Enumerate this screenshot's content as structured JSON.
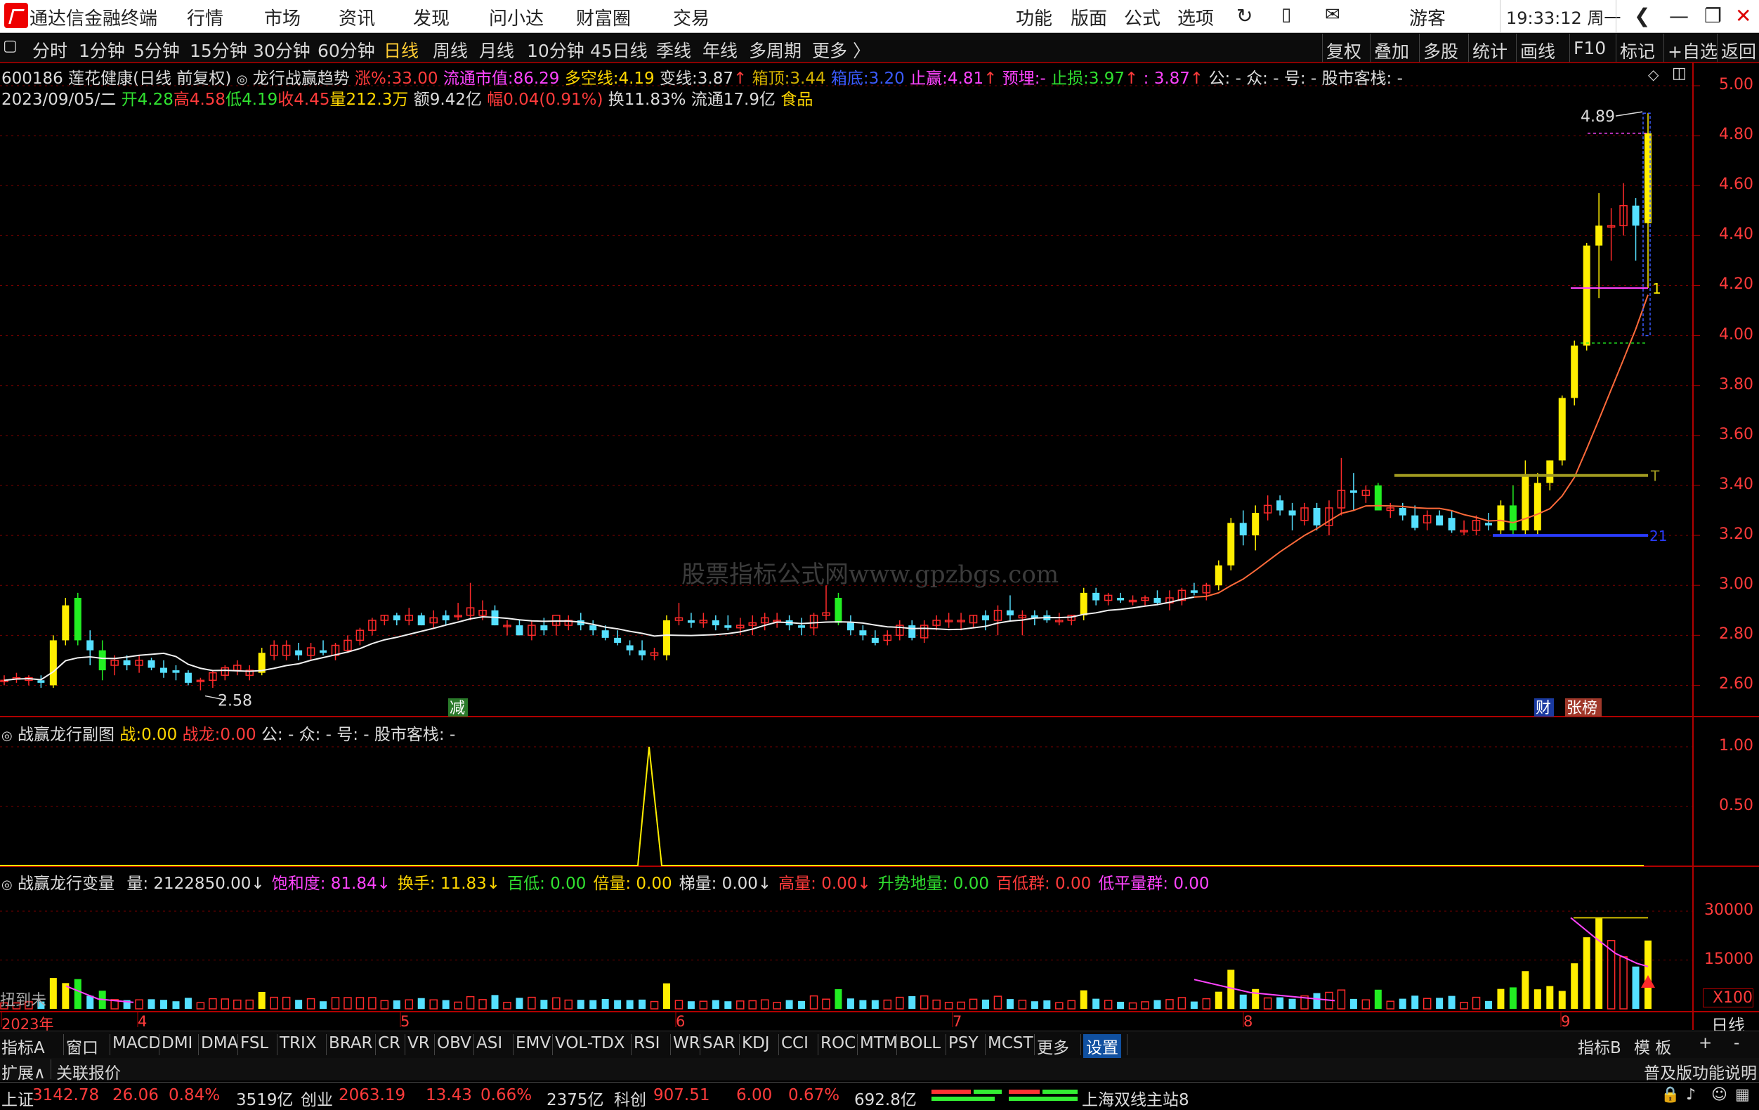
{
  "titlebar": {
    "app_name": "通达信金融终端",
    "menu": [
      "行情",
      "市场",
      "资讯",
      "发现",
      "问小达",
      "财富圈",
      "交易"
    ],
    "right_menu": [
      "功能",
      "版面",
      "公式",
      "选项"
    ],
    "user": "游客",
    "clock": "19:33:12 周一"
  },
  "periods": [
    "分时",
    "1分钟",
    "5分钟",
    "15分钟",
    "30分钟",
    "60分钟",
    "日线",
    "周线",
    "月线",
    "10分钟",
    "45日线",
    "季线",
    "年线",
    "多周期",
    "更多 〉"
  ],
  "active_period": "日线",
  "right_tools": [
    "复权",
    "叠加",
    "多股",
    "统计",
    "画线",
    "F10",
    "标记",
    "+自选",
    "返回"
  ],
  "main_info": {
    "stock": "600186 莲花健康(日线 前复权)",
    "indicator_name": "龙行战赢趋势",
    "zhang_label": "涨%:",
    "zhang_val": "33.00",
    "ltsz_label": "流通市值:",
    "ltsz_val": "86.29",
    "dkx_label": "多空线:",
    "dkx_val": "4.19",
    "bx_label": "变线:",
    "bx_val": "3.87",
    "xd_label": "箱顶:",
    "xd_val": "3.44",
    "xdi_label": "箱底:",
    "xdi_val": "3.20",
    "zy_label": "止赢:",
    "zy_val": "4.81",
    "ym_label": "预埋:",
    "ym_val": "-",
    "zs_label": "止损:",
    "zs_val": "3.97",
    "extra": ": 3.87",
    "tail": "公: -  众: -  号: -  股市客栈: -"
  },
  "ohlc_line": {
    "date": "2023/09/05/二",
    "open": "开4.28",
    "high": "高4.58",
    "low": "低4.19",
    "close": "收4.45",
    "vol": "量212.3万",
    "amt": "额9.42亿",
    "amp": "幅0.04(0.91%)",
    "turn": "换11.83%",
    "float": "流通17.9亿",
    "sector": "食品"
  },
  "price_axis": [
    "5.00",
    "4.80",
    "4.60",
    "4.40",
    "4.20",
    "4.00",
    "3.80",
    "3.60",
    "3.40",
    "3.20",
    "3.00",
    "2.80",
    "2.60"
  ],
  "sub_axis": [
    "1.00",
    "0.50"
  ],
  "vol_axis": [
    "30000",
    "15000",
    "X100"
  ],
  "chart_labels": {
    "high_mark": "4.89",
    "low_mark": "2.58",
    "box_top_tag": "T",
    "box_bottom_tag": "21",
    "stop_tag": "1",
    "event_jian": "减",
    "event_cai": "财",
    "event_zb": "张榜",
    "watermark": "股票指标公式网www.gpzbgs.com"
  },
  "sub_info": {
    "name": "战赢龙行副图",
    "z_label": "战:",
    "z_val": "0.00",
    "zl_label": "战龙:",
    "zl_val": "0.00",
    "tail": "公: -  众: -  号: -  股市客栈: -"
  },
  "vol_info": {
    "name": "战赢龙行变量",
    "items": [
      {
        "label": "量:",
        "val": "2122850.00↓",
        "color": "#dcdcdc"
      },
      {
        "label": "饱和度:",
        "val": "81.84↓",
        "color": "#ff44ff"
      },
      {
        "label": "换手:",
        "val": "11.83↓",
        "color": "#ffd700"
      },
      {
        "label": "百低:",
        "val": "0.00",
        "color": "#30e030"
      },
      {
        "label": "倍量:",
        "val": "0.00",
        "color": "#ffd700"
      },
      {
        "label": "梯量:",
        "val": "0.00↓",
        "color": "#dcdcdc"
      },
      {
        "label": "高量:",
        "val": "0.00↓",
        "color": "#ff3b3b"
      },
      {
        "label": "升势地量:",
        "val": "0.00",
        "color": "#30e030"
      },
      {
        "label": "百低群:",
        "val": "0.00",
        "color": "#ff3b3b"
      },
      {
        "label": "低平量群:",
        "val": "0.00",
        "color": "#ff44ff"
      }
    ],
    "left_note": "扭到未"
  },
  "date_axis": [
    "2023年",
    "4",
    "5",
    "6",
    "7",
    "8",
    "9"
  ],
  "date_right": "日线",
  "indicator_tabs": [
    "指标A",
    "窗口",
    "MACD",
    "DMI",
    "DMA",
    "FSL",
    "TRIX",
    "BRAR",
    "CR",
    "VR",
    "OBV",
    "ASI",
    "EMV",
    "VOL-TDX",
    "RSI",
    "WR",
    "SAR",
    "KDJ",
    "CCI",
    "ROC",
    "MTM",
    "BOLL",
    "PSY",
    "MCST",
    "更多",
    "设置"
  ],
  "indicator_right": [
    "指标B",
    "模 板",
    "+",
    "-"
  ],
  "expand": [
    "扩展∧",
    "关联报价"
  ],
  "expand_right": "普及版功能说明",
  "status": {
    "sh_name": "上证",
    "sh_val": "3142.78",
    "sh_chg": "26.06",
    "sh_pct": "0.84%",
    "sh_amt": "3519亿",
    "cy_name": "创业",
    "cy_val": "2063.19",
    "cy_chg": "13.43",
    "cy_pct": "0.66%",
    "cy_amt": "2375亿",
    "kc_name": "科创",
    "kc_val": "907.51",
    "kc_chg": "6.00",
    "kc_pct": "0.67%",
    "kc_amt": "692.8亿",
    "server": "上海双线主站8"
  },
  "candles": [
    [
      2.62,
      2.64,
      2.6,
      2.62
    ],
    [
      2.63,
      2.65,
      2.61,
      2.63
    ],
    [
      2.62,
      2.64,
      2.6,
      2.63
    ],
    [
      2.62,
      2.64,
      2.59,
      2.61
    ],
    [
      2.6,
      2.8,
      2.59,
      2.78
    ],
    [
      2.78,
      2.95,
      2.76,
      2.92
    ],
    [
      2.95,
      2.97,
      2.76,
      2.78
    ],
    [
      2.78,
      2.82,
      2.68,
      2.74
    ],
    [
      2.74,
      2.78,
      2.62,
      2.66
    ],
    [
      2.68,
      2.72,
      2.64,
      2.7
    ],
    [
      2.7,
      2.72,
      2.66,
      2.68
    ],
    [
      2.68,
      2.72,
      2.65,
      2.7
    ],
    [
      2.7,
      2.71,
      2.66,
      2.67
    ],
    [
      2.67,
      2.7,
      2.63,
      2.65
    ],
    [
      2.66,
      2.68,
      2.62,
      2.65
    ],
    [
      2.65,
      2.66,
      2.6,
      2.61
    ],
    [
      2.62,
      2.63,
      2.58,
      2.62
    ],
    [
      2.62,
      2.66,
      2.59,
      2.65
    ],
    [
      2.64,
      2.68,
      2.62,
      2.67
    ],
    [
      2.66,
      2.7,
      2.64,
      2.68
    ],
    [
      2.64,
      2.68,
      2.62,
      2.66
    ],
    [
      2.65,
      2.75,
      2.64,
      2.73
    ],
    [
      2.72,
      2.78,
      2.7,
      2.76
    ],
    [
      2.72,
      2.78,
      2.7,
      2.76
    ],
    [
      2.74,
      2.77,
      2.7,
      2.72
    ],
    [
      2.72,
      2.77,
      2.7,
      2.75
    ],
    [
      2.74,
      2.78,
      2.72,
      2.73
    ],
    [
      2.72,
      2.77,
      2.7,
      2.76
    ],
    [
      2.74,
      2.8,
      2.73,
      2.78
    ],
    [
      2.78,
      2.83,
      2.76,
      2.82
    ],
    [
      2.82,
      2.87,
      2.8,
      2.86
    ],
    [
      2.86,
      2.88,
      2.84,
      2.88
    ],
    [
      2.88,
      2.89,
      2.84,
      2.86
    ],
    [
      2.86,
      2.91,
      2.84,
      2.88
    ],
    [
      2.88,
      2.89,
      2.84,
      2.84
    ],
    [
      2.85,
      2.9,
      2.83,
      2.87
    ],
    [
      2.88,
      2.9,
      2.84,
      2.86
    ],
    [
      2.88,
      2.93,
      2.86,
      2.88
    ],
    [
      2.88,
      3.01,
      2.86,
      2.91
    ],
    [
      2.88,
      2.94,
      2.86,
      2.9
    ],
    [
      2.9,
      2.92,
      2.84,
      2.84
    ],
    [
      2.84,
      2.86,
      2.8,
      2.84
    ],
    [
      2.84,
      2.86,
      2.8,
      2.8
    ],
    [
      2.8,
      2.86,
      2.78,
      2.84
    ],
    [
      2.84,
      2.87,
      2.8,
      2.82
    ],
    [
      2.84,
      2.86,
      2.8,
      2.88
    ],
    [
      2.84,
      2.88,
      2.82,
      2.86
    ],
    [
      2.86,
      2.89,
      2.82,
      2.84
    ],
    [
      2.84,
      2.86,
      2.8,
      2.82
    ],
    [
      2.82,
      2.84,
      2.78,
      2.79
    ],
    [
      2.79,
      2.82,
      2.76,
      2.77
    ],
    [
      2.76,
      2.78,
      2.72,
      2.74
    ],
    [
      2.74,
      2.78,
      2.7,
      2.72
    ],
    [
      2.72,
      2.75,
      2.7,
      2.73
    ],
    [
      2.72,
      2.88,
      2.7,
      2.86
    ],
    [
      2.86,
      2.93,
      2.84,
      2.87
    ],
    [
      2.86,
      2.89,
      2.83,
      2.85
    ],
    [
      2.85,
      2.89,
      2.83,
      2.86
    ],
    [
      2.86,
      2.88,
      2.82,
      2.84
    ],
    [
      2.84,
      2.88,
      2.82,
      2.83
    ],
    [
      2.83,
      2.87,
      2.8,
      2.84
    ],
    [
      2.84,
      2.88,
      2.8,
      2.85
    ],
    [
      2.85,
      2.89,
      2.82,
      2.87
    ],
    [
      2.86,
      2.89,
      2.83,
      2.86
    ],
    [
      2.86,
      2.88,
      2.82,
      2.84
    ],
    [
      2.84,
      2.87,
      2.8,
      2.83
    ],
    [
      2.83,
      2.89,
      2.8,
      2.88
    ],
    [
      2.88,
      3.0,
      2.86,
      2.89
    ],
    [
      2.95,
      2.97,
      2.84,
      2.85
    ],
    [
      2.85,
      2.88,
      2.8,
      2.82
    ],
    [
      2.82,
      2.84,
      2.78,
      2.8
    ],
    [
      2.79,
      2.82,
      2.76,
      2.77
    ],
    [
      2.78,
      2.82,
      2.76,
      2.8
    ],
    [
      2.8,
      2.86,
      2.78,
      2.84
    ],
    [
      2.84,
      2.86,
      2.78,
      2.79
    ],
    [
      2.79,
      2.86,
      2.77,
      2.84
    ],
    [
      2.84,
      2.88,
      2.82,
      2.86
    ],
    [
      2.86,
      2.89,
      2.83,
      2.86
    ],
    [
      2.86,
      2.89,
      2.82,
      2.86
    ],
    [
      2.85,
      2.88,
      2.83,
      2.88
    ],
    [
      2.88,
      2.9,
      2.82,
      2.86
    ],
    [
      2.86,
      2.92,
      2.8,
      2.9
    ],
    [
      2.9,
      2.96,
      2.86,
      2.88
    ],
    [
      2.87,
      2.9,
      2.8,
      2.88
    ],
    [
      2.88,
      2.9,
      2.84,
      2.87
    ],
    [
      2.88,
      2.9,
      2.85,
      2.86
    ],
    [
      2.86,
      2.89,
      2.84,
      2.86
    ],
    [
      2.86,
      2.88,
      2.84,
      2.88
    ],
    [
      2.88,
      2.99,
      2.86,
      2.97
    ],
    [
      2.97,
      2.99,
      2.92,
      2.94
    ],
    [
      2.94,
      2.97,
      2.92,
      2.96
    ],
    [
      2.95,
      2.97,
      2.93,
      2.94
    ],
    [
      2.94,
      2.96,
      2.92,
      2.94
    ],
    [
      2.94,
      2.96,
      2.92,
      2.95
    ],
    [
      2.95,
      2.98,
      2.92,
      2.93
    ],
    [
      2.93,
      2.98,
      2.9,
      2.95
    ],
    [
      2.94,
      2.99,
      2.92,
      2.98
    ],
    [
      2.98,
      3.01,
      2.96,
      2.97
    ],
    [
      2.97,
      3.01,
      2.94,
      3.0
    ],
    [
      3.0,
      3.1,
      2.98,
      3.08
    ],
    [
      3.08,
      3.27,
      3.06,
      3.25
    ],
    [
      3.25,
      3.3,
      3.16,
      3.2
    ],
    [
      3.2,
      3.32,
      3.14,
      3.29
    ],
    [
      3.29,
      3.36,
      3.26,
      3.32
    ],
    [
      3.34,
      3.36,
      3.28,
      3.3
    ],
    [
      3.3,
      3.33,
      3.22,
      3.28
    ],
    [
      3.26,
      3.33,
      3.24,
      3.31
    ],
    [
      3.31,
      3.33,
      3.22,
      3.24
    ],
    [
      3.24,
      3.34,
      3.2,
      3.31
    ],
    [
      3.31,
      3.51,
      3.28,
      3.38
    ],
    [
      3.38,
      3.45,
      3.3,
      3.37
    ],
    [
      3.36,
      3.4,
      3.33,
      3.38
    ],
    [
      3.4,
      3.41,
      3.3,
      3.3
    ],
    [
      3.3,
      3.33,
      3.27,
      3.31
    ],
    [
      3.31,
      3.33,
      3.26,
      3.28
    ],
    [
      3.28,
      3.32,
      3.22,
      3.23
    ],
    [
      3.25,
      3.3,
      3.22,
      3.28
    ],
    [
      3.28,
      3.3,
      3.24,
      3.24
    ],
    [
      3.27,
      3.3,
      3.21,
      3.22
    ],
    [
      3.22,
      3.26,
      3.2,
      3.22
    ],
    [
      3.22,
      3.28,
      3.2,
      3.26
    ],
    [
      3.25,
      3.29,
      3.22,
      3.24
    ],
    [
      3.22,
      3.34,
      3.2,
      3.32
    ],
    [
      3.32,
      3.4,
      3.2,
      3.22
    ],
    [
      3.22,
      3.5,
      3.2,
      3.44
    ],
    [
      3.22,
      3.45,
      3.2,
      3.41
    ],
    [
      3.41,
      3.5,
      3.38,
      3.5
    ],
    [
      3.5,
      3.76,
      3.48,
      3.75
    ],
    [
      3.75,
      3.98,
      3.72,
      3.96
    ],
    [
      3.96,
      4.37,
      3.94,
      4.36
    ],
    [
      4.36,
      4.57,
      4.15,
      4.44
    ],
    [
      4.44,
      4.51,
      4.3,
      4.44
    ],
    [
      4.44,
      4.61,
      4.4,
      4.52
    ],
    [
      4.52,
      4.55,
      4.3,
      4.44
    ],
    [
      4.45,
      4.89,
      4.19,
      4.81
    ]
  ]
}
